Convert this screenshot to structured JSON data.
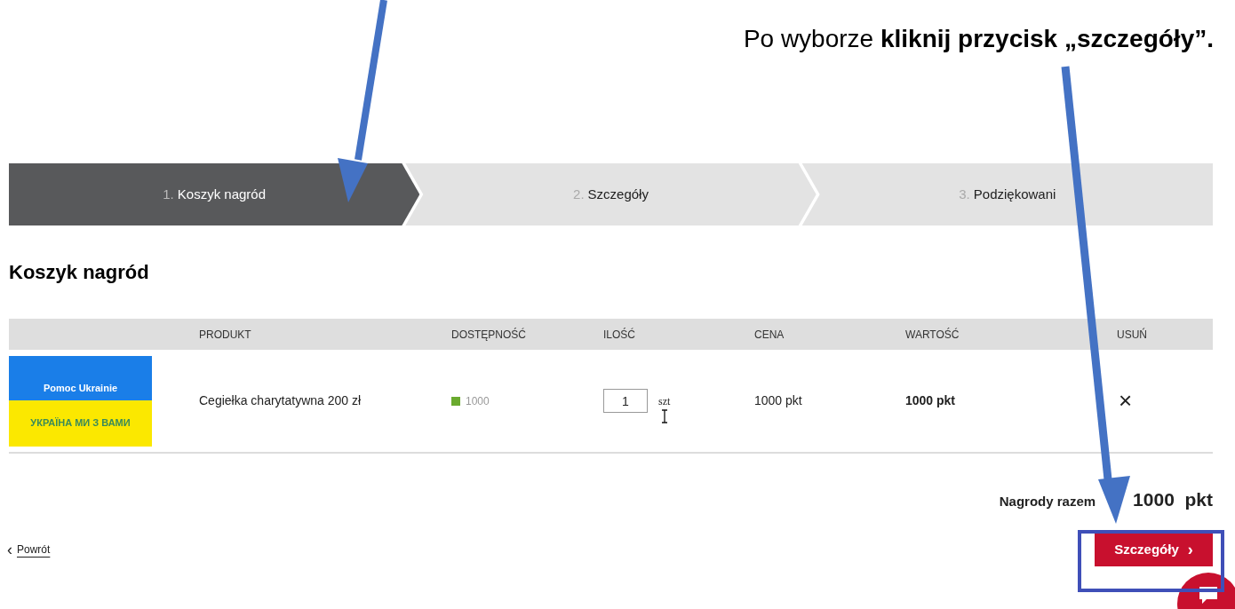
{
  "annotation": {
    "text": "Po wyborze **kliknij przycisk „szczegóły”.**"
  },
  "steps": [
    {
      "number": "1.",
      "label": "Koszyk nagród",
      "selected": true
    },
    {
      "number": "2.",
      "label": "Szczegóły",
      "selected": false
    },
    {
      "number": "3.",
      "label": "Podziękowani",
      "selected": false
    }
  ],
  "heading": "Koszyk nagród",
  "table": {
    "columns": [
      "PRODUKT",
      "DOSTĘPNOŚĆ",
      "ILOŚĆ",
      "CENA",
      "WARTOŚĆ",
      "USUŃ"
    ],
    "rows": [
      {
        "banner_top": "Pomoc Ukrainie",
        "banner_bottom": "УКРАЇНА МИ З ВАМИ",
        "product": "Cegiełka charytatywna 200 zł",
        "availability": "1000",
        "color": "#6aaa2e",
        "quantity": "1",
        "unit": "szt",
        "price": "1000 pkt",
        "value": "1000 pkt",
        "remove": "×"
      }
    ]
  },
  "total": {
    "label": "Nagrody razem",
    "value": "1000  pkt"
  },
  "back": {
    "icon": "‹",
    "label": "Powrót"
  },
  "next_button": {
    "label": "Szczegóły",
    "icon": "›"
  }
}
